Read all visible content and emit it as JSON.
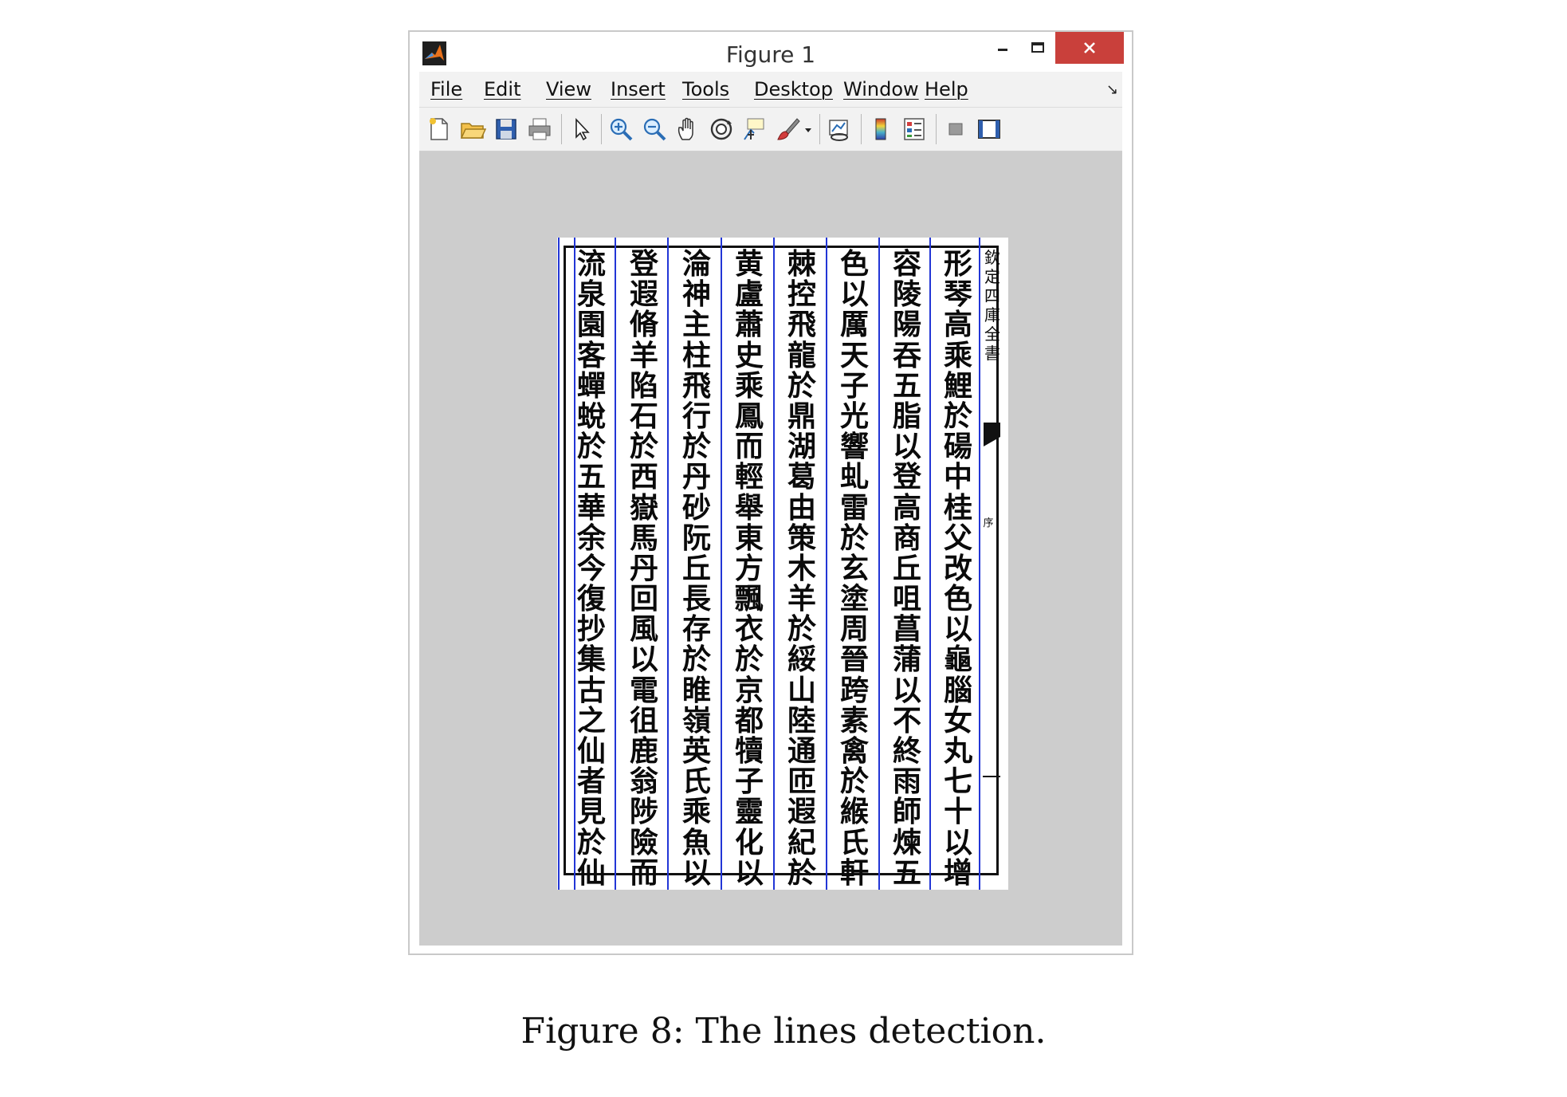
{
  "window": {
    "title": "Figure 1"
  },
  "menu": {
    "items": [
      "File",
      "Edit",
      "View",
      "Insert",
      "Tools",
      "Desktop",
      "Window",
      "Help"
    ]
  },
  "toolbar": {
    "icons": [
      "new-figure-icon",
      "open-file-icon",
      "save-icon",
      "print-icon",
      "edit-plot-icon",
      "zoom-in-icon",
      "zoom-out-icon",
      "pan-icon",
      "rotate-3d-icon",
      "data-cursor-icon",
      "brush-icon",
      "link-plot-icon",
      "colorbar-icon",
      "legend-icon",
      "hide-plot-tools-icon",
      "show-plot-tools-icon"
    ]
  },
  "document": {
    "columns": [
      "流泉園客蟬蛻於五華余今復抄集古之仙者見於仙",
      "登遐脩羊陷石於西嶽馬丹回風以電徂鹿翁陟險而",
      "淪神主柱飛行於丹砂阮丘長存於睢嶺英氏乘魚以",
      "黄盧蕭史乘鳳而輕舉東方飄衣於京都犢子靈化以",
      "棘控飛龍於鼎湖葛由策木羊於綏山陸通匝遐紀於",
      "色以厲天子光響虬雷於玄塗周晉跨素禽於緱氏軒",
      "容陵陽吞五脂以登高商丘咀菖蒲以不終雨師煉五",
      "形琴高乘鯉於碭中桂父改色以龜腦女丸七十以增"
    ],
    "margin_header": "欽定四庫全書",
    "margin_note": "序"
  },
  "caption": "Figure 8: The lines detection."
}
